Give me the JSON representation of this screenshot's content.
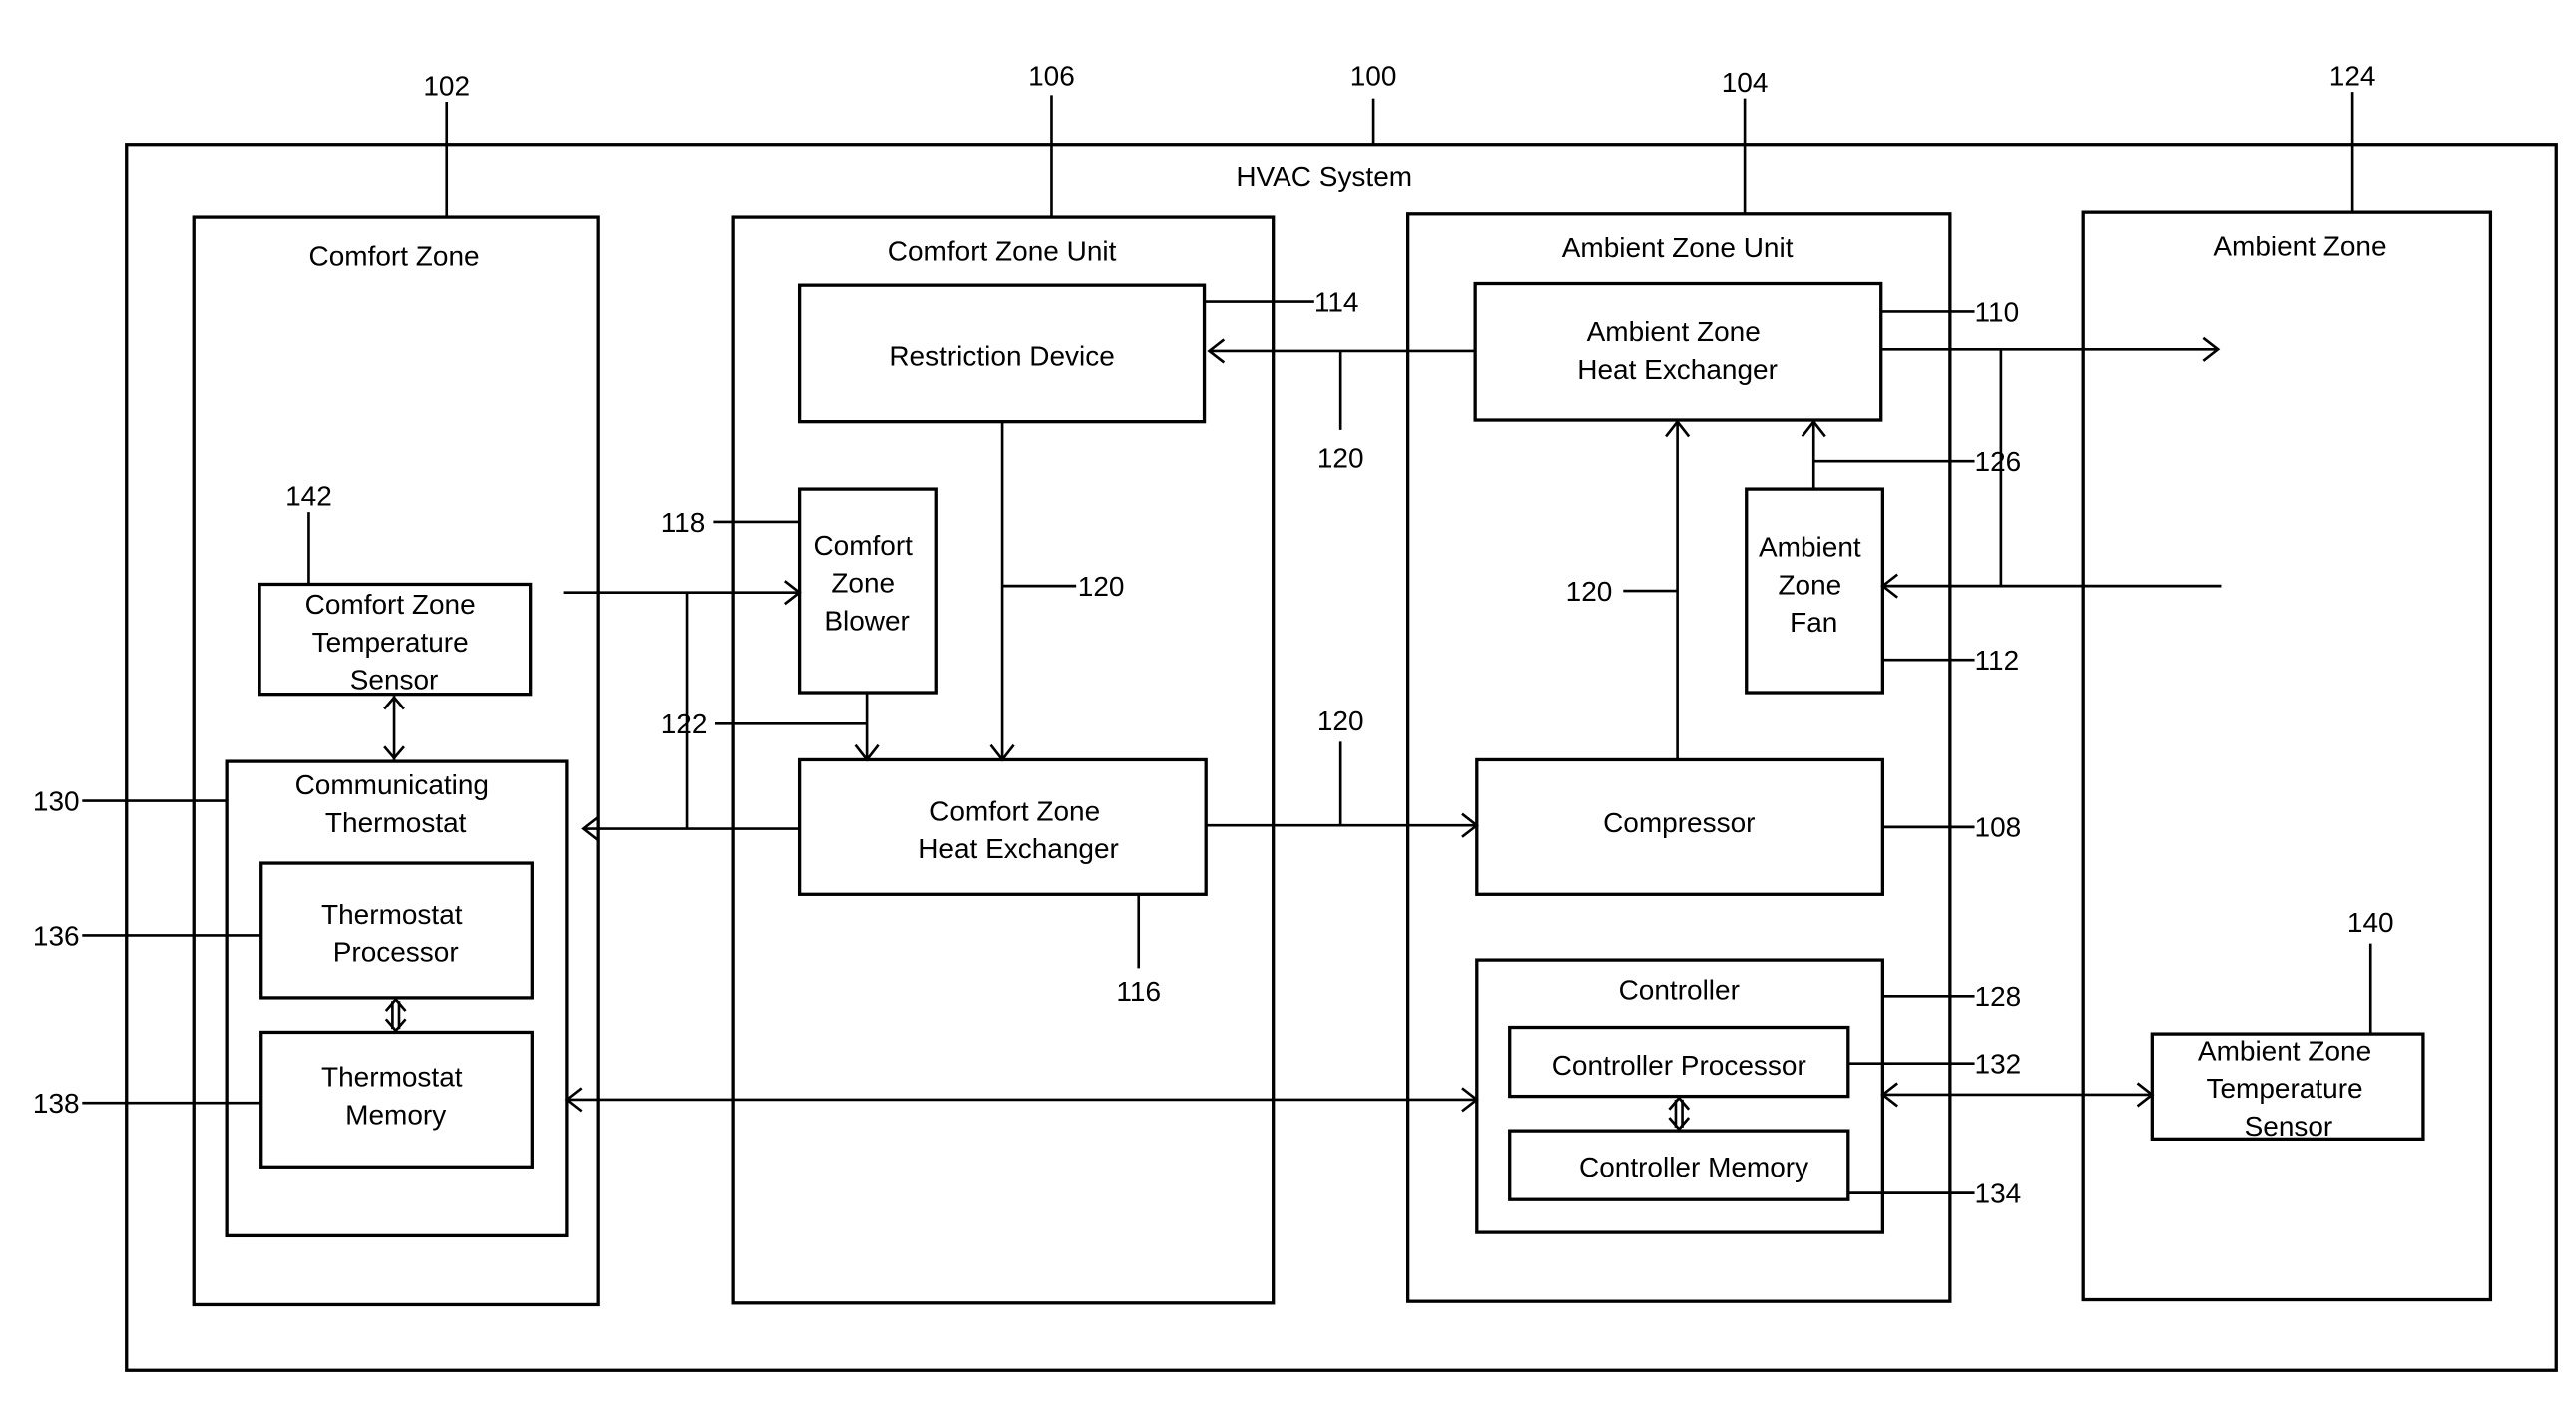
{
  "diagram": {
    "title": "HVAC System",
    "ref_system": "100",
    "zones": {
      "comfort_zone": {
        "label": "Comfort Zone",
        "ref": "102"
      },
      "comfort_zone_unit": {
        "label": "Comfort Zone Unit",
        "ref": "106"
      },
      "ambient_zone_unit": {
        "label": "Ambient Zone Unit",
        "ref": "104"
      },
      "ambient_zone": {
        "label": "Ambient Zone",
        "ref": "124"
      }
    },
    "components": {
      "restriction_device": {
        "label": "Restriction Device",
        "ref": "114"
      },
      "comfort_zone_blower": {
        "lines": [
          "Comfort",
          "Zone",
          "Blower"
        ],
        "ref": "118"
      },
      "comfort_zone_heat_exchanger": {
        "lines": [
          "Comfort Zone",
          "Heat Exchanger"
        ],
        "ref": "116"
      },
      "ambient_zone_heat_exchanger": {
        "lines": [
          "Ambient Zone",
          "Heat Exchanger"
        ],
        "ref": "110"
      },
      "ambient_zone_fan": {
        "lines": [
          "Ambient",
          "Zone",
          "Fan"
        ],
        "ref": "112"
      },
      "compressor": {
        "label": "Compressor",
        "ref": "108"
      },
      "controller": {
        "label": "Controller",
        "ref": "128"
      },
      "controller_processor": {
        "label": "Controller Processor",
        "ref": "132"
      },
      "controller_memory": {
        "label": "Controller Memory",
        "ref": "134"
      },
      "comfort_zone_temperature_sensor": {
        "lines": [
          "Comfort Zone",
          "Temperature",
          "Sensor"
        ],
        "ref": "142"
      },
      "communicating_thermostat": {
        "lines": [
          "Communicating",
          "Thermostat"
        ],
        "ref": "130"
      },
      "thermostat_processor": {
        "lines": [
          "Thermostat",
          "Processor"
        ],
        "ref": "136"
      },
      "thermostat_memory": {
        "lines": [
          "Thermostat",
          "Memory"
        ],
        "ref": "138"
      },
      "ambient_zone_temperature_sensor": {
        "lines": [
          "Ambient Zone",
          "Temperature",
          "Sensor"
        ],
        "ref": "140"
      }
    },
    "connection_refs": {
      "refrigerant_line": "120",
      "comfort_air_flow": "122",
      "ambient_air_flow": "126"
    }
  }
}
